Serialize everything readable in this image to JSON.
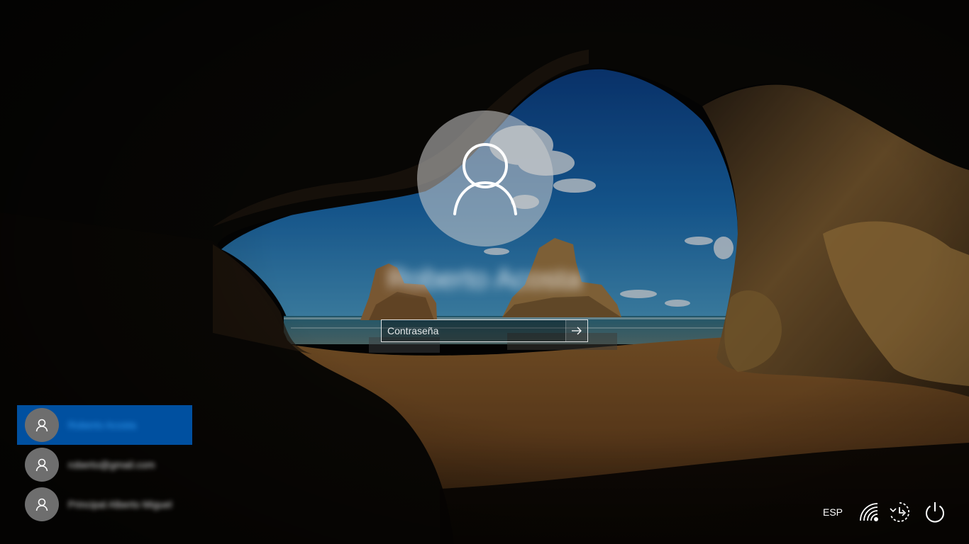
{
  "lock_screen": {
    "username": "Roberto Acosta",
    "password_placeholder": "Contraseña",
    "submit_icon": "arrow-right-icon"
  },
  "users": [
    {
      "name": "Roberto Acosta",
      "selected": true,
      "icon": "person-icon"
    },
    {
      "name": "roberto@gmail.com",
      "selected": false,
      "icon": "person-icon"
    },
    {
      "name": "Principal Alberto Miguel",
      "selected": false,
      "icon": "person-icon"
    }
  ],
  "tray": {
    "language": "ESP",
    "icons": [
      "network-icon",
      "ease-of-access-icon",
      "power-icon"
    ]
  },
  "colors": {
    "selected_user_bg": "#0050a0",
    "text": "#ffffff"
  }
}
